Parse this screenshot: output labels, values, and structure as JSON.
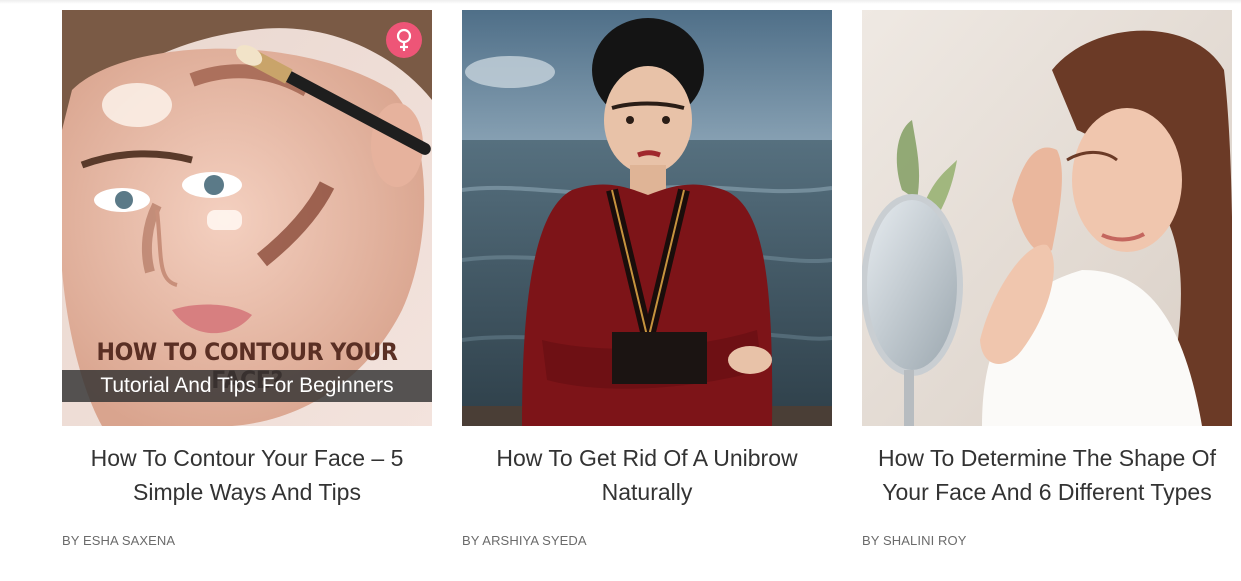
{
  "articles": [
    {
      "title": "How To Contour Your Face – 5 Simple Ways And Tips",
      "byline": "BY ESHA SAXENA",
      "image_headline": "HOW TO CONTOUR YOUR FACE?",
      "image_subtitle": "Tutorial And Tips For Beginners",
      "badge_icon": "female-symbol-icon",
      "badge_color": "#ee5577"
    },
    {
      "title": "How To Get Rid Of A Unibrow Naturally",
      "byline": "BY ARSHIYA SYEDA"
    },
    {
      "title": "How To Determine The Shape Of Your Face And 6 Different Types",
      "byline": "BY SHALINI ROY"
    }
  ]
}
